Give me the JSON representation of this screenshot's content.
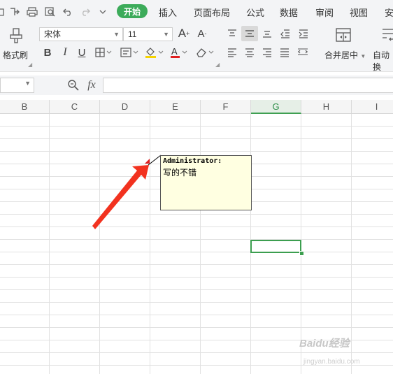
{
  "menubar": {
    "quick_access": [
      "folder-icon",
      "split-icon",
      "print-icon",
      "print-preview-icon",
      "undo-icon",
      "redo-icon",
      "more-icon"
    ],
    "tabs": [
      {
        "label": "开始",
        "active": true
      },
      {
        "label": "插入"
      },
      {
        "label": "页面布局"
      },
      {
        "label": "公式"
      },
      {
        "label": "数据"
      },
      {
        "label": "审阅"
      },
      {
        "label": "视图"
      },
      {
        "label": "安"
      }
    ],
    "accent_color": "#3cab5a"
  },
  "ribbon": {
    "format_painter_label": "格式刷",
    "font_name": "宋体",
    "font_size": "11",
    "increase_font": "A",
    "decrease_font": "A",
    "bold": "B",
    "italic": "I",
    "underline": "U",
    "font_color_letter": "A",
    "merge_label": "合并居中",
    "autowrap_label": "自动换"
  },
  "formula_bar": {
    "fx_label": "fx",
    "value": ""
  },
  "columns": [
    "B",
    "C",
    "D",
    "E",
    "F",
    "G",
    "H",
    "I"
  ],
  "selected_column": "G",
  "comment": {
    "author": "Administrator:",
    "text": "写的不错"
  },
  "watermark": {
    "brand": "Baidu经验",
    "url": "jingyan.baidu.com"
  }
}
